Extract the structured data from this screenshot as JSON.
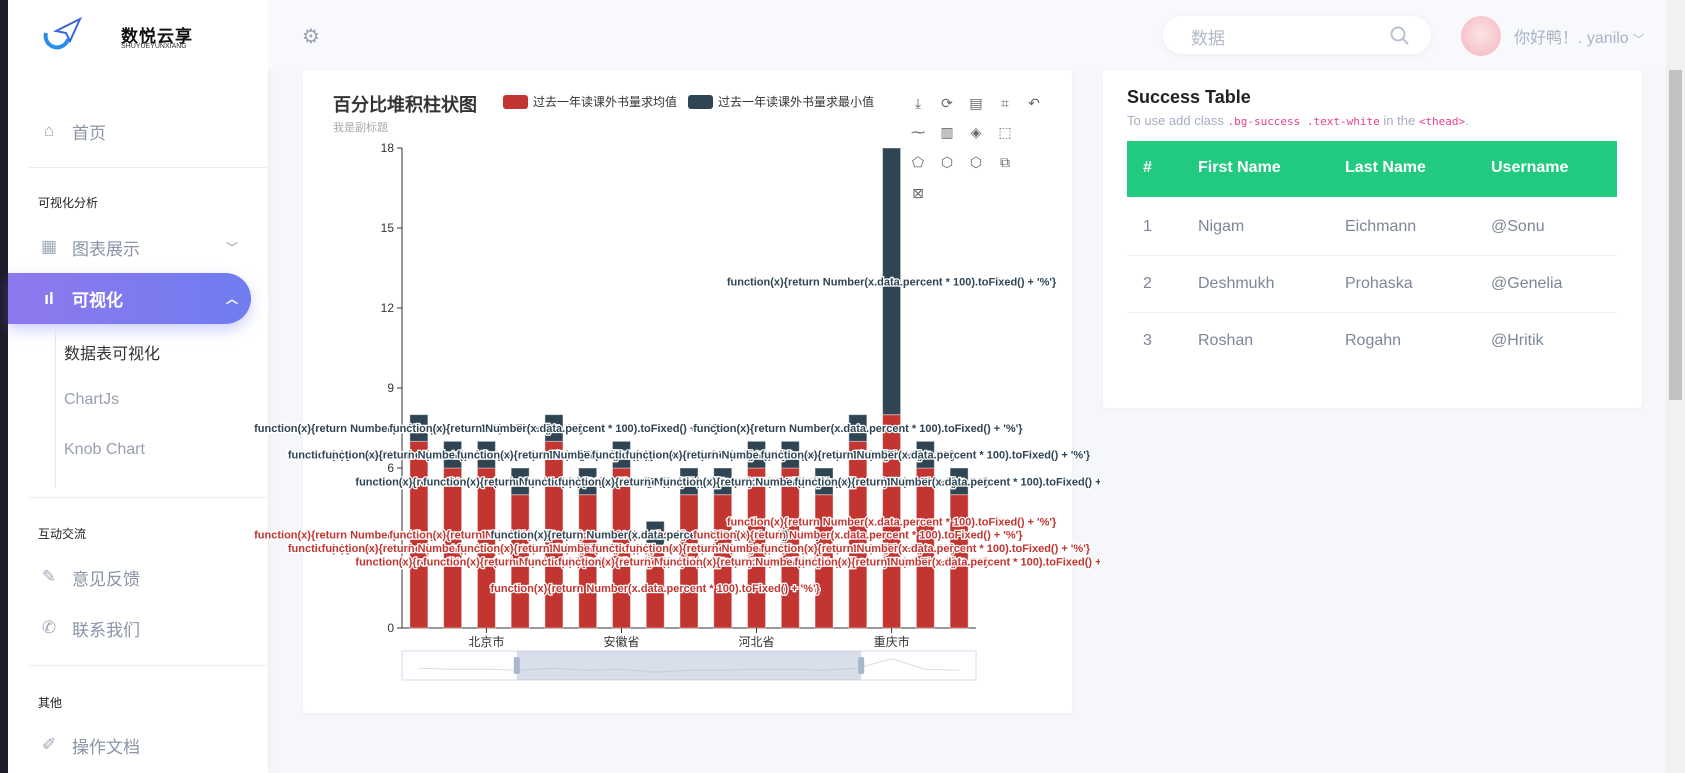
{
  "brand": {
    "name": "数悦云享",
    "sub": "SHUYUEYUNXIANG"
  },
  "sidebar": {
    "home": "首页",
    "section1": "可视化分析",
    "charts": "图表展示",
    "visual": "可视化",
    "sub_items": [
      "数据表可视化",
      "ChartJs",
      "Knob Chart"
    ],
    "section2": "互动交流",
    "feedback": "意见反馈",
    "contact": "联系我们",
    "section3": "其他",
    "docs": "操作文档"
  },
  "header": {
    "search_placeholder": "数据",
    "greeting": "你好鸭！. yanilo"
  },
  "chart_data": {
    "type": "bar",
    "stacked": true,
    "title": "百分比堆积柱状图",
    "subtitle": "我是副标题",
    "legend_position": "top",
    "categories": [
      "",
      "",
      "北京市",
      "",
      "",
      "",
      "安徽省",
      "",
      "",
      "",
      "河北省",
      "",
      "",
      "",
      "重庆市",
      "",
      ""
    ],
    "series": [
      {
        "name": "过去一年读课外书量求均值",
        "color": "#c23531",
        "values": [
          7,
          6,
          6,
          5,
          7,
          5,
          6,
          3,
          5,
          5,
          6,
          6,
          5,
          7,
          8,
          6,
          5
        ]
      },
      {
        "name": "过去一年读课外书量求最小值",
        "color": "#2f4554",
        "values": [
          1,
          1,
          1,
          1,
          1,
          1,
          1,
          1,
          1,
          1,
          1,
          1,
          1,
          1,
          10,
          1,
          1
        ]
      }
    ],
    "label_text": "function(x){return Number(x.data.percent * 100).toFixed() + '%'}",
    "ylim": [
      0,
      18
    ],
    "yticks": [
      0,
      3,
      6,
      9,
      12,
      15,
      18
    ],
    "grid": false,
    "datazoom": {
      "start": 0.2,
      "end": 0.8
    }
  },
  "table": {
    "title": "Success Table",
    "desc_pre": "To use add class ",
    "code1": ".bg-success .text-white",
    "desc_mid": " in the ",
    "code2": "<thead>",
    "desc_post": ".",
    "header_color": "#22ca80",
    "columns": [
      "#",
      "First Name",
      "Last Name",
      "Username"
    ],
    "rows": [
      [
        "1",
        "Nigam",
        "Eichmann",
        "@Sonu"
      ],
      [
        "2",
        "Deshmukh",
        "Prohaska",
        "@Genelia"
      ],
      [
        "3",
        "Roshan",
        "Rogahn",
        "@Hritik"
      ]
    ]
  }
}
